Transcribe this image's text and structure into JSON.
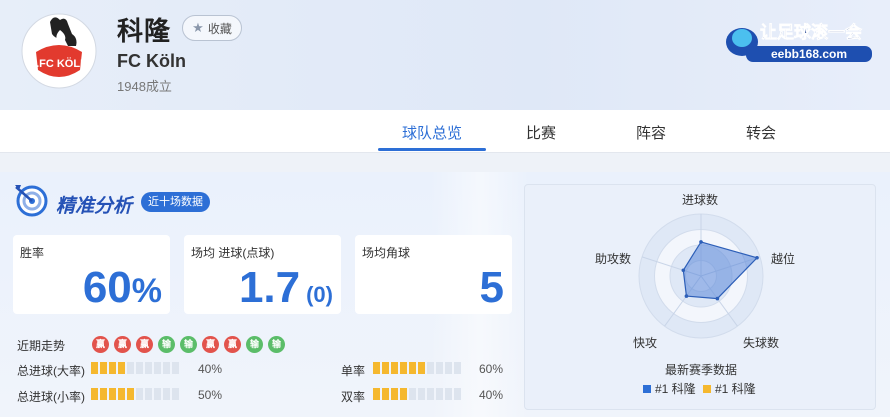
{
  "header": {
    "club_name": "科隆",
    "fav_label": "收藏",
    "club_en": "FC Köln",
    "founded": "1948成立",
    "logo_text": "1.FC KÖLN",
    "brand_text": "让足球滚一会",
    "brand_sub": "eebb168.com"
  },
  "tabs": [
    {
      "label": "球队总览",
      "active": true
    },
    {
      "label": "比赛",
      "active": false
    },
    {
      "label": "阵容",
      "active": false
    },
    {
      "label": "转会",
      "active": false
    }
  ],
  "analysis": {
    "title": "精准分析",
    "badge": "近十场数据",
    "cards": [
      {
        "label": "胜率",
        "value": "60",
        "unit": "%"
      },
      {
        "label": "场均 进球(点球)",
        "value": "1.7",
        "sub": "(0)"
      },
      {
        "label": "场均角球",
        "value": "5"
      }
    ],
    "trend_label": "近期走势",
    "trend": [
      {
        "r": "赢",
        "type": "win"
      },
      {
        "r": "赢",
        "type": "win"
      },
      {
        "r": "赢",
        "type": "win"
      },
      {
        "r": "输",
        "type": "lose"
      },
      {
        "r": "输",
        "type": "lose"
      },
      {
        "r": "赢",
        "type": "win"
      },
      {
        "r": "赢",
        "type": "win"
      },
      {
        "r": "输",
        "type": "lose"
      },
      {
        "r": "输",
        "type": "lose"
      }
    ],
    "stats": [
      {
        "label": "总进球(大率)",
        "value": "40%",
        "fraction": 0.4
      },
      {
        "label": "总进球(小率)",
        "value": "50%",
        "fraction": 0.5
      },
      {
        "label": "单率",
        "value": "60%",
        "fraction": 0.6
      },
      {
        "label": "双率",
        "value": "40%",
        "fraction": 0.4
      }
    ]
  },
  "radar": {
    "axes": [
      "进球数",
      "越位",
      "失球数",
      "快攻",
      "助攻数"
    ],
    "values": [
      0.55,
      0.95,
      0.45,
      0.4,
      0.3
    ],
    "caption": "最新赛季数据",
    "legend": [
      {
        "label": "#1 科隆",
        "color": "#2d6fd6"
      },
      {
        "label": "#1 科隆",
        "color": "#f5b82e"
      }
    ],
    "colors": {
      "fill": "#5a86d8",
      "stroke": "#2d5fb8"
    }
  },
  "colors": {
    "accent": "#2d6fd6",
    "win": "#e2534c",
    "lose": "#5bbd69",
    "bar": "#f5b82e"
  }
}
